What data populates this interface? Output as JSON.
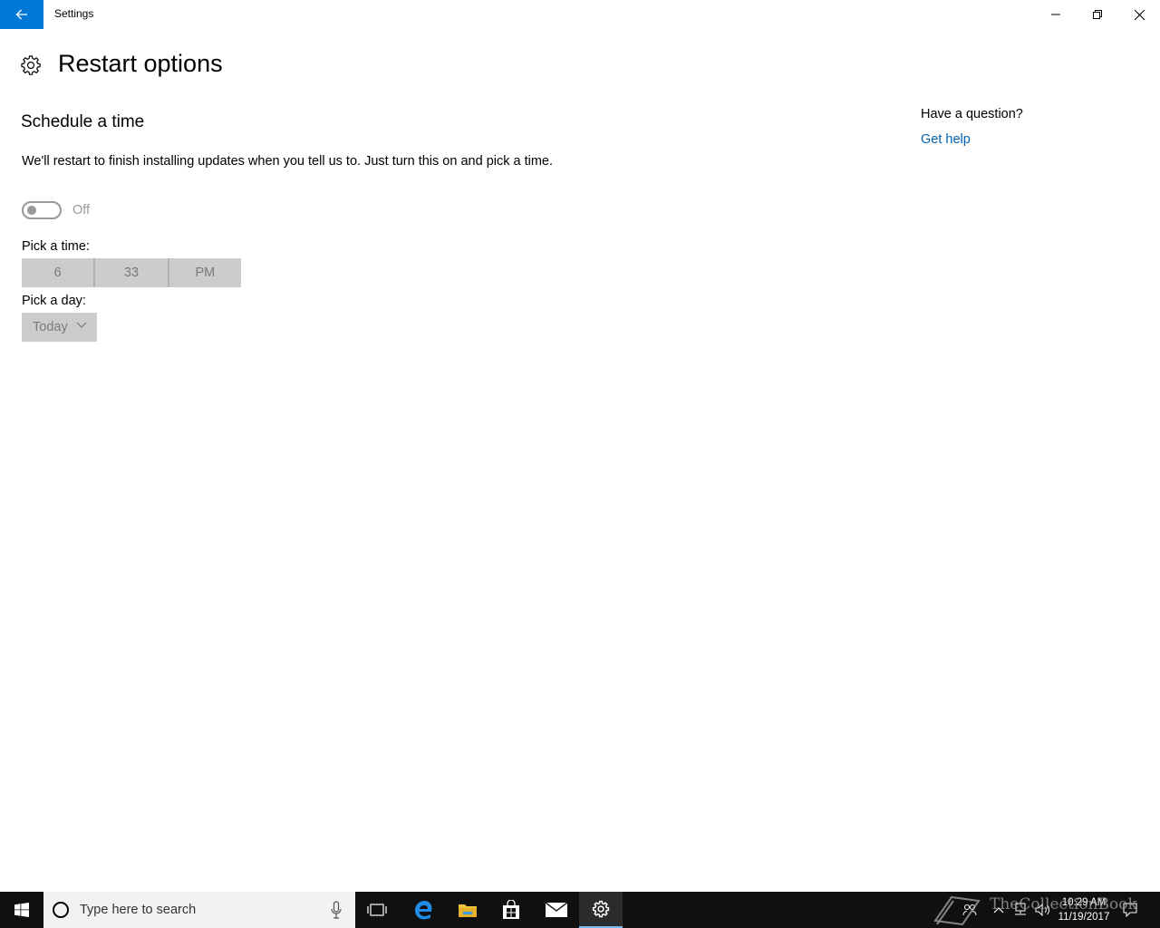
{
  "window": {
    "title": "Settings",
    "back_icon": "arrow-left-icon",
    "controls": [
      "minimize-icon",
      "restore-icon",
      "close-icon"
    ]
  },
  "page": {
    "icon": "gear-icon",
    "title": "Restart options",
    "section_title": "Schedule a time",
    "description": "We'll restart to finish installing updates when you tell us to. Just turn this on and pick a time.",
    "toggle": {
      "state_label": "Off",
      "on": false
    },
    "time_label": "Pick a time:",
    "time": {
      "hour": "6",
      "minute": "33",
      "period": "PM"
    },
    "day_label": "Pick a day:",
    "day": {
      "selected": "Today"
    }
  },
  "help": {
    "question": "Have a question?",
    "link": "Get help"
  },
  "taskbar": {
    "search_placeholder": "Type here to search",
    "apps": [
      "task-view-icon",
      "edge-icon",
      "file-explorer-icon",
      "store-icon",
      "mail-icon",
      "settings-icon"
    ],
    "active_app": "settings-icon",
    "clock": {
      "time": "10:29 AM",
      "date": "11/19/2017"
    },
    "watermark": "TheCollectionBook"
  },
  "colors": {
    "accent": "#0078d7",
    "link": "#0063b1",
    "taskbar": "#101010",
    "disabled_control": "#cccccc"
  }
}
